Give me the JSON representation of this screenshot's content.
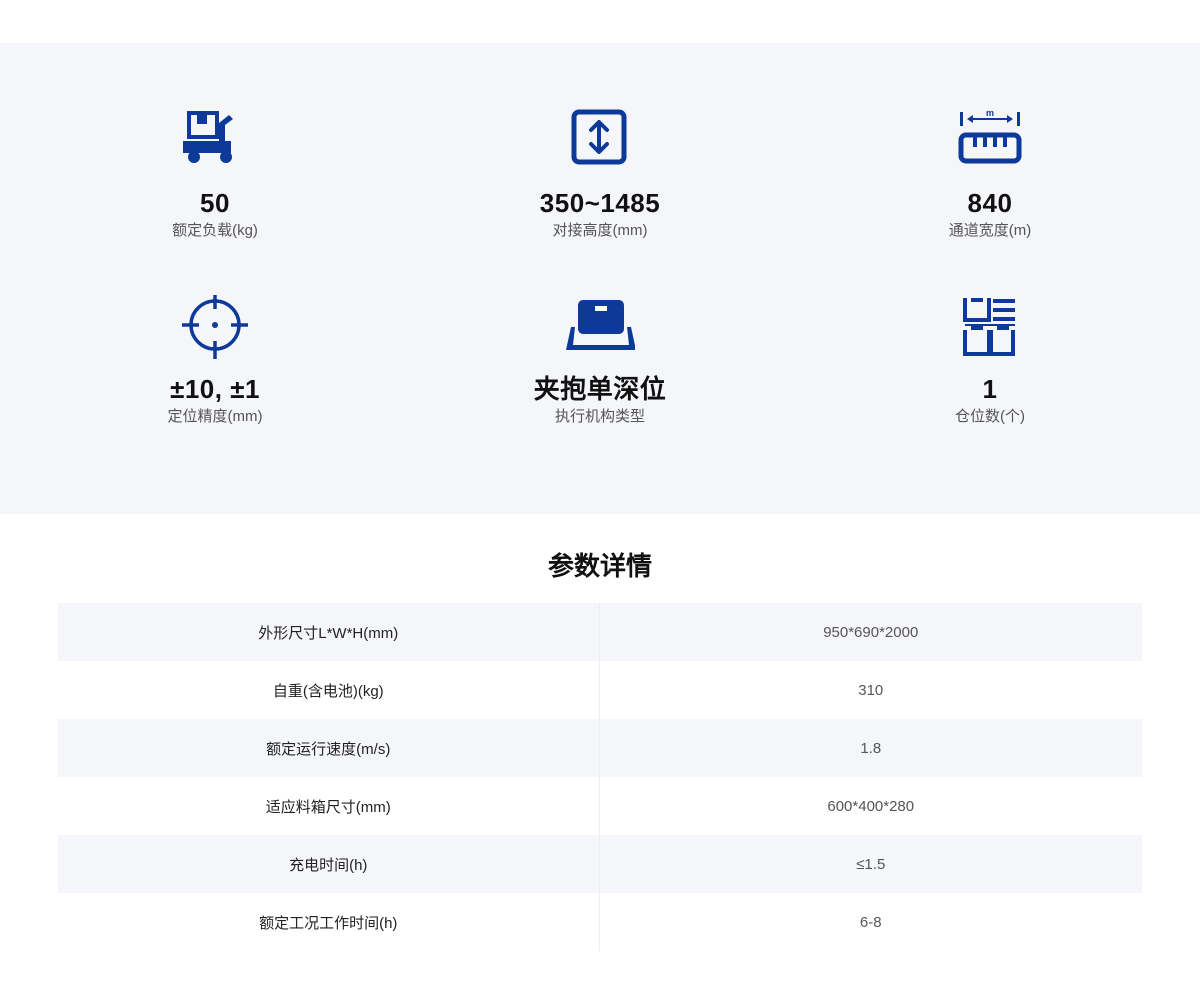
{
  "specs": [
    {
      "value": "50",
      "label": "额定负载(kg)",
      "icon": "cart-icon"
    },
    {
      "value": "350~1485",
      "label": "对接高度(mm)",
      "icon": "height-arrow-icon"
    },
    {
      "value": "840",
      "label": "通道宽度(m)",
      "icon": "ruler-width-icon",
      "icon_text": "m"
    },
    {
      "value": "±10, ±1",
      "label": "定位精度(mm)",
      "icon": "crosshair-icon"
    },
    {
      "value": "夹抱单深位",
      "label": "执行机构类型",
      "icon": "tray-box-icon"
    },
    {
      "value": "1",
      "label": "仓位数(个)",
      "icon": "shelf-bins-icon"
    }
  ],
  "details": {
    "title": "参数详情",
    "rows": [
      {
        "name": "外形尺寸L*W*H(mm)",
        "value": "950*690*2000"
      },
      {
        "name": "自重(含电池)(kg)",
        "value": "310"
      },
      {
        "name": "额定运行速度(m/s)",
        "value": "1.8"
      },
      {
        "name": "适应料箱尺寸(mm)",
        "value": "600*400*280"
      },
      {
        "name": "充电时间(h)",
        "value": "≤1.5"
      },
      {
        "name": "额定工况工作时间(h)",
        "value": "6-8"
      }
    ]
  },
  "colors": {
    "accent": "#0d3a99",
    "panel_bg": "#f5f6fa",
    "row_alt": "#f5f6fa"
  }
}
